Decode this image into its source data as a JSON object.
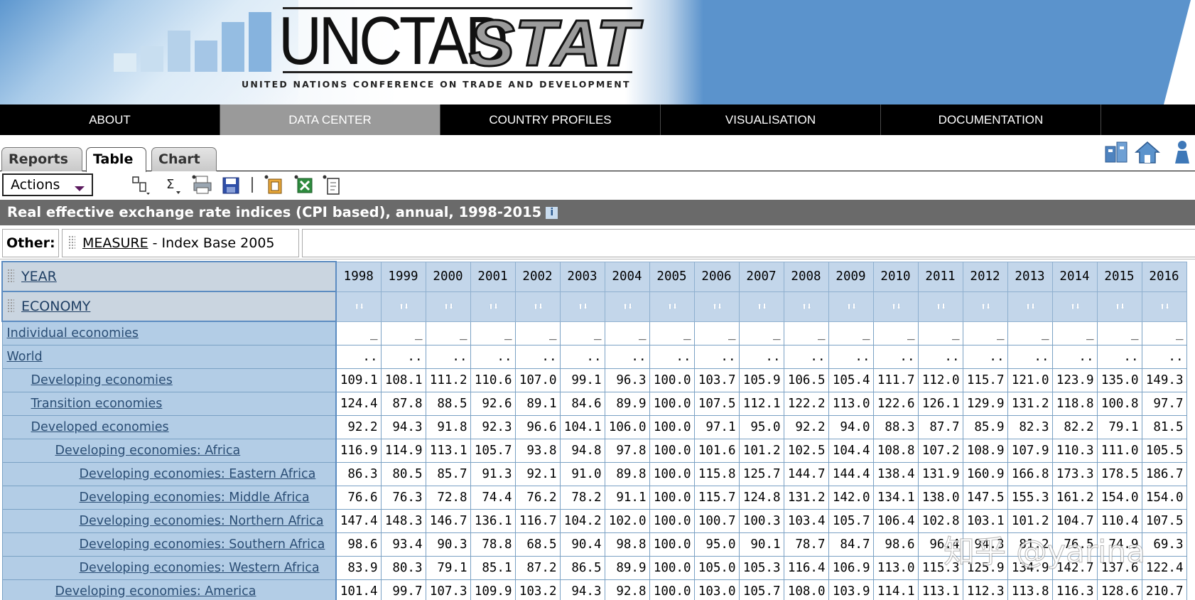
{
  "brand": {
    "logo_main": "UNCTAD",
    "logo_accent": "STAT",
    "subtitle": "UNITED NATIONS CONFERENCE ON TRADE AND DEVELOPMENT"
  },
  "nav": {
    "items": [
      {
        "label": "ABOUT"
      },
      {
        "label": "DATA CENTER"
      },
      {
        "label": "COUNTRY PROFILES"
      },
      {
        "label": "VISUALISATION"
      },
      {
        "label": "DOCUMENTATION"
      },
      {
        "label": ""
      }
    ],
    "active_index": 1
  },
  "tabs": [
    {
      "label": "Reports"
    },
    {
      "label": "Table"
    },
    {
      "label": "Chart"
    }
  ],
  "active_tab": "Table",
  "toolbar": {
    "actions_label": "Actions",
    "icons": [
      "pivot-icon",
      "sum-icon",
      "print-icon",
      "save-icon",
      "export-excel-icon",
      "export-xls-icon",
      "export-file-icon"
    ]
  },
  "top_icons": [
    "metadata-icon",
    "home-icon",
    "user-icon"
  ],
  "report": {
    "title": "Real effective exchange rate indices (CPI based), annual, 1998-2015",
    "info_glyph": "i"
  },
  "other": {
    "label": "Other:",
    "dimension": "MEASURE",
    "value": " - Index Base 2005"
  },
  "table": {
    "row_dim_1": "YEAR",
    "row_dim_2": "ECONOMY",
    "years": [
      "1998",
      "1999",
      "2000",
      "2001",
      "2002",
      "2003",
      "2004",
      "2005",
      "2006",
      "2007",
      "2008",
      "2009",
      "2010",
      "2011",
      "2012",
      "2013",
      "2014",
      "2015",
      "2016"
    ],
    "sort_glyph": "⬆⬇",
    "rows": [
      {
        "label": "Individual economies",
        "level": 0,
        "values": [
          "_",
          "_",
          "_",
          "_",
          "_",
          "_",
          "_",
          "_",
          "_",
          "_",
          "_",
          "_",
          "_",
          "_",
          "_",
          "_",
          "_",
          "_",
          "_"
        ]
      },
      {
        "label": "World",
        "level": 0,
        "values": [
          "..",
          "..",
          "..",
          "..",
          "..",
          "..",
          "..",
          "..",
          "..",
          "..",
          "..",
          "..",
          "..",
          "..",
          "..",
          "..",
          "..",
          "..",
          ".."
        ]
      },
      {
        "label": "Developing economies",
        "level": 1,
        "values": [
          "109.1",
          "108.1",
          "111.2",
          "110.6",
          "107.0",
          "99.1",
          "96.3",
          "100.0",
          "103.7",
          "105.9",
          "106.5",
          "105.4",
          "111.7",
          "112.0",
          "115.7",
          "121.0",
          "123.9",
          "135.0",
          "149.3"
        ]
      },
      {
        "label": "Transition economies",
        "level": 1,
        "values": [
          "124.4",
          "87.8",
          "88.5",
          "92.6",
          "89.1",
          "84.6",
          "89.9",
          "100.0",
          "107.5",
          "112.1",
          "122.2",
          "113.0",
          "122.6",
          "126.1",
          "129.9",
          "131.2",
          "118.8",
          "100.8",
          "97.7"
        ]
      },
      {
        "label": "Developed economies",
        "level": 1,
        "values": [
          "92.2",
          "94.3",
          "91.8",
          "92.3",
          "96.6",
          "104.1",
          "106.0",
          "100.0",
          "97.1",
          "95.0",
          "92.2",
          "94.0",
          "88.3",
          "87.7",
          "85.9",
          "82.3",
          "82.2",
          "79.1",
          "81.5"
        ]
      },
      {
        "label": "Developing economies: Africa",
        "level": 2,
        "values": [
          "116.9",
          "114.9",
          "113.1",
          "105.7",
          "93.8",
          "94.8",
          "97.8",
          "100.0",
          "101.6",
          "101.2",
          "102.5",
          "104.4",
          "108.8",
          "107.2",
          "108.9",
          "107.9",
          "110.3",
          "111.0",
          "105.5"
        ]
      },
      {
        "label": "Developing economies: Eastern Africa",
        "level": 3,
        "values": [
          "86.3",
          "80.5",
          "85.7",
          "91.3",
          "92.1",
          "91.0",
          "89.8",
          "100.0",
          "115.8",
          "125.7",
          "144.7",
          "144.4",
          "138.4",
          "131.9",
          "160.9",
          "166.8",
          "173.3",
          "178.5",
          "186.7"
        ]
      },
      {
        "label": "Developing economies: Middle Africa",
        "level": 3,
        "values": [
          "76.6",
          "76.3",
          "72.8",
          "74.4",
          "76.2",
          "78.2",
          "91.1",
          "100.0",
          "115.7",
          "124.8",
          "131.2",
          "142.0",
          "134.1",
          "138.0",
          "147.5",
          "155.3",
          "161.2",
          "154.0",
          "154.0"
        ]
      },
      {
        "label": "Developing economies: Northern Africa",
        "level": 3,
        "values": [
          "147.4",
          "148.3",
          "146.7",
          "136.1",
          "116.7",
          "104.2",
          "102.0",
          "100.0",
          "100.7",
          "100.3",
          "103.4",
          "105.7",
          "106.4",
          "102.8",
          "103.1",
          "101.2",
          "104.7",
          "110.4",
          "107.5"
        ]
      },
      {
        "label": "Developing economies: Southern Africa",
        "level": 3,
        "values": [
          "98.6",
          "93.4",
          "90.3",
          "78.8",
          "68.5",
          "90.4",
          "98.8",
          "100.0",
          "95.0",
          "90.1",
          "78.7",
          "84.7",
          "98.6",
          "96.4",
          "94.3",
          "81.2",
          "76.5",
          "74.9",
          "69.3"
        ]
      },
      {
        "label": "Developing economies: Western Africa",
        "level": 3,
        "values": [
          "83.9",
          "80.3",
          "79.1",
          "85.1",
          "87.2",
          "86.5",
          "89.9",
          "100.0",
          "105.0",
          "105.3",
          "116.4",
          "106.9",
          "113.0",
          "115.3",
          "125.9",
          "134.9",
          "142.7",
          "137.6",
          "122.4"
        ]
      },
      {
        "label": "Developing economies: America",
        "level": 2,
        "values": [
          "101.4",
          "99.7",
          "107.3",
          "109.9",
          "103.2",
          "94.3",
          "92.8",
          "100.0",
          "103.0",
          "105.7",
          "108.0",
          "103.9",
          "114.1",
          "113.1",
          "112.3",
          "113.8",
          "116.3",
          "128.6",
          "210.7"
        ]
      }
    ]
  },
  "watermark": "知乎 @yarina",
  "colors": {
    "nav_bg": "#000000",
    "nav_active": "#9a9a9a",
    "titlebar_bg": "#6a6a6a",
    "row_header_bg": "#b3cde6",
    "year_header_bg": "#c3d6ea",
    "link_color": "#2a4d74"
  }
}
